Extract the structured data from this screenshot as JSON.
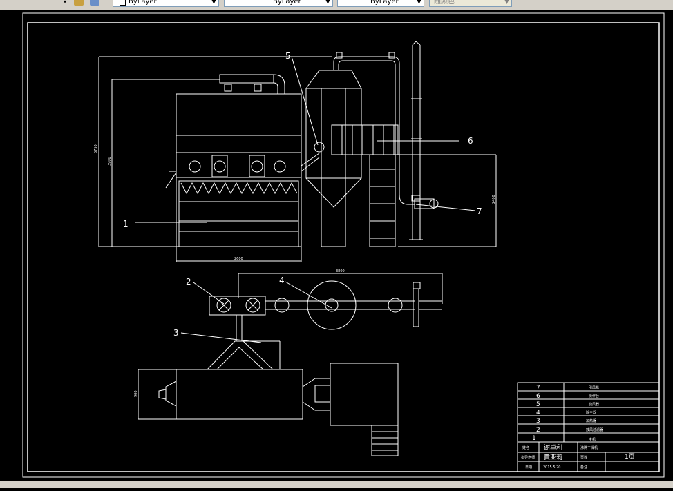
{
  "toolbar": {
    "layer_color_value": "ByLayer",
    "linetype_value": "ByLayer",
    "lineweight_value": "ByLayer",
    "plotstyle_value": "随颜色"
  },
  "drawing": {
    "callouts": [
      "1",
      "2",
      "3",
      "4",
      "5",
      "6",
      "7"
    ],
    "dimensions": {
      "overall_height": "5750",
      "body_height": "3900",
      "body_width": "2600",
      "cyclone_height": "2400",
      "plan_length": "3800",
      "blower_height": "900"
    }
  },
  "title_block": {
    "parts": [
      {
        "no": "7",
        "name": "引风机"
      },
      {
        "no": "6",
        "name": "操作台"
      },
      {
        "no": "5",
        "name": "旋风器"
      },
      {
        "no": "4",
        "name": "除尘器"
      },
      {
        "no": "3",
        "name": "加热器"
      },
      {
        "no": "2",
        "name": "鼓风过滤器"
      },
      {
        "no": "1",
        "name": "主机"
      }
    ],
    "designer_label": "姓名",
    "designer_name": "谢卓利",
    "school_label": "指导老师",
    "school_name": "黄亚莉",
    "title": "沸腾干燥机",
    "scale_label": "页数",
    "sheet": "1页",
    "date_label": "日期",
    "date": "2015.5.20",
    "remark_label": "备注"
  },
  "colors": {
    "background": "#000000",
    "lines": "#ffffff",
    "toolbar": "#d4d0c8"
  }
}
